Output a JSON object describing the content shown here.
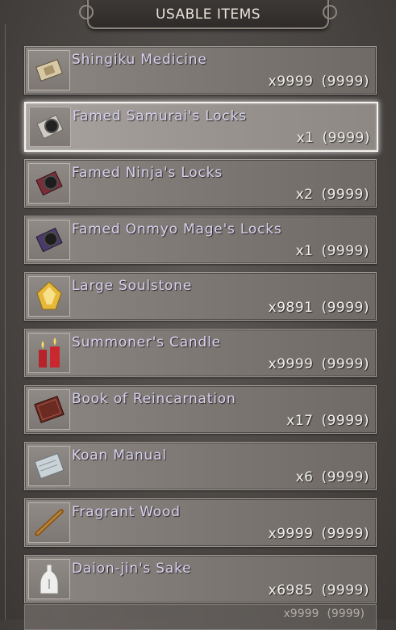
{
  "header": {
    "title": "USABLE ITEMS"
  },
  "items": [
    {
      "name": "Shingiku Medicine",
      "qty": "x9999",
      "max": "(9999)",
      "icon": "medicine-packet-icon"
    },
    {
      "name": "Famed Samurai's Locks",
      "qty": "x1",
      "max": "(9999)",
      "icon": "samurai-locks-icon",
      "selected": true
    },
    {
      "name": "Famed Ninja's Locks",
      "qty": "x2",
      "max": "(9999)",
      "icon": "ninja-locks-icon"
    },
    {
      "name": "Famed Onmyo Mage's Locks",
      "qty": "x1",
      "max": "(9999)",
      "icon": "onmyo-locks-icon"
    },
    {
      "name": "Large Soulstone",
      "qty": "x9891",
      "max": "(9999)",
      "icon": "soulstone-icon"
    },
    {
      "name": "Summoner's Candle",
      "qty": "x9999",
      "max": "(9999)",
      "icon": "candle-icon"
    },
    {
      "name": "Book of Reincarnation",
      "qty": "x17",
      "max": "(9999)",
      "icon": "book-icon"
    },
    {
      "name": "Koan Manual",
      "qty": "x6",
      "max": "(9999)",
      "icon": "manual-icon"
    },
    {
      "name": "Fragrant Wood",
      "qty": "x9999",
      "max": "(9999)",
      "icon": "wood-icon"
    },
    {
      "name": "Daion-jin's Sake",
      "qty": "x6985",
      "max": "(9999)",
      "icon": "sake-bottle-icon"
    }
  ],
  "partial_item": {
    "qty": "x9999",
    "max": "(9999)"
  }
}
